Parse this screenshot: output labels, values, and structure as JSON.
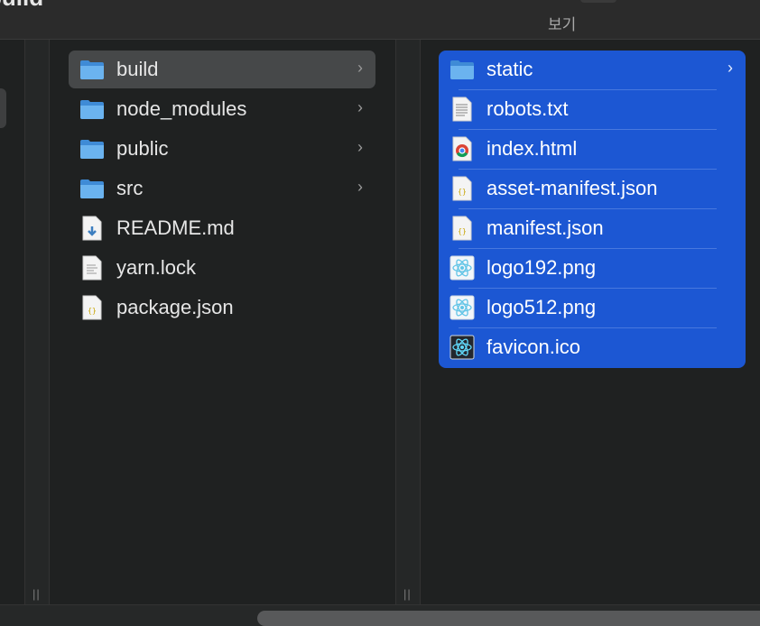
{
  "window": {
    "title": "build"
  },
  "toolbar": {
    "view_label": "보기"
  },
  "column_parent": {
    "items": [
      {
        "name": "build",
        "kind": "folder",
        "icon": "folder-icon",
        "selected": true,
        "has_children": true
      },
      {
        "name": "node_modules",
        "kind": "folder",
        "icon": "folder-icon",
        "has_children": true
      },
      {
        "name": "public",
        "kind": "folder",
        "icon": "folder-icon",
        "has_children": true
      },
      {
        "name": "src",
        "kind": "folder",
        "icon": "folder-icon",
        "has_children": true
      },
      {
        "name": "README.md",
        "kind": "file",
        "icon": "markdown-file-icon"
      },
      {
        "name": "yarn.lock",
        "kind": "file",
        "icon": "text-file-icon"
      },
      {
        "name": "package.json",
        "kind": "file",
        "icon": "json-file-icon"
      }
    ]
  },
  "column_build": {
    "items": [
      {
        "name": "static",
        "kind": "folder",
        "icon": "folder-icon",
        "has_children": true
      },
      {
        "name": "robots.txt",
        "kind": "file",
        "icon": "text-file-icon"
      },
      {
        "name": "index.html",
        "kind": "file",
        "icon": "chrome-html-icon"
      },
      {
        "name": "asset-manifest.json",
        "kind": "file",
        "icon": "json-file-icon"
      },
      {
        "name": "manifest.json",
        "kind": "file",
        "icon": "json-file-icon"
      },
      {
        "name": "logo192.png",
        "kind": "file",
        "icon": "react-logo-icon"
      },
      {
        "name": "logo512.png",
        "kind": "file",
        "icon": "react-logo-icon"
      },
      {
        "name": "favicon.ico",
        "kind": "file",
        "icon": "react-favicon-icon"
      }
    ]
  },
  "icons": {
    "chevron": "›",
    "resize": "||",
    "json_glyph": "{}"
  },
  "colors": {
    "selection_blue": "#1c57d3",
    "folder_blue": "#5aa5e8",
    "row_highlight": "#464849",
    "background": "#1f2121"
  }
}
